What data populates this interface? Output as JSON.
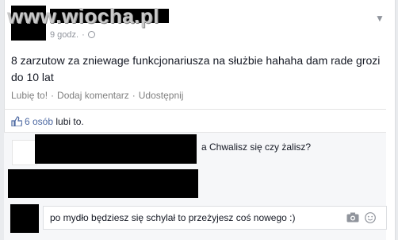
{
  "watermark": "www.wiocha.pl",
  "post": {
    "timestamp": "9 godz.",
    "timestamp_sep": "·",
    "text": "8 zarzutow za zniewage funkcjonariusza na służbie hahaha dam rade grozi do 10 lat",
    "actions": {
      "like": "Lubię to!",
      "comment": "Dodaj komentarz",
      "share": "Udostępnij",
      "separator": "·"
    },
    "likes": {
      "count": "6 osób",
      "suffix": "lubi to."
    }
  },
  "comments": [
    {
      "text": "a Chwalisz się czy żalisz?"
    }
  ],
  "composer": {
    "text": "po mydło będziesz się schylał to przeżyjesz coś nowego :)"
  },
  "colors": {
    "link": "#4b67a1",
    "muted": "#90949c",
    "redaction": "#000000"
  },
  "icons": [
    "chevron-down-icon",
    "globe-icon",
    "like-thumb-icon",
    "camera-icon",
    "emoji-icon"
  ]
}
